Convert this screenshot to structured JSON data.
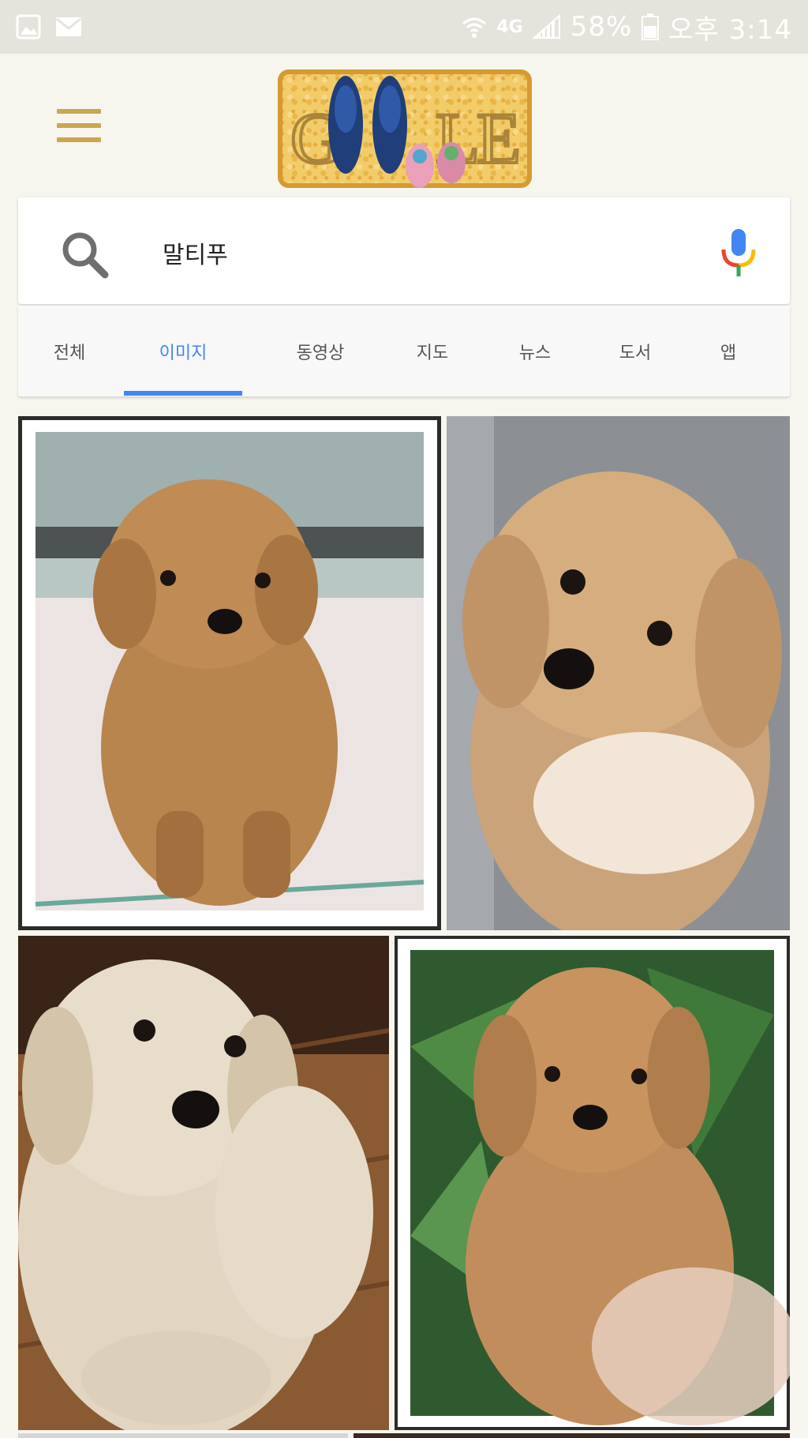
{
  "status_bar": {
    "network": "4G",
    "battery": "58%",
    "time": "오후 3:14",
    "icons": [
      "gallery-icon",
      "mail-icon",
      "wifi-icon",
      "signal-icon",
      "battery-icon"
    ]
  },
  "header": {
    "menu_icon": "hamburger-menu-icon",
    "logo_text": "GOOGLE"
  },
  "search": {
    "query": "말티푸",
    "search_icon": "search-icon",
    "voice_icon": "microphone-icon"
  },
  "tabs": [
    {
      "label": "전체",
      "active": false
    },
    {
      "label": "이미지",
      "active": true
    },
    {
      "label": "동영상",
      "active": false
    },
    {
      "label": "지도",
      "active": false
    },
    {
      "label": "뉴스",
      "active": false
    },
    {
      "label": "도서",
      "active": false
    },
    {
      "label": "앱",
      "active": false
    }
  ],
  "colors": {
    "accent": "#4285f4",
    "background": "#f7f6ee",
    "status_bar": "#e5e4dc",
    "menu": "#c9a650"
  }
}
